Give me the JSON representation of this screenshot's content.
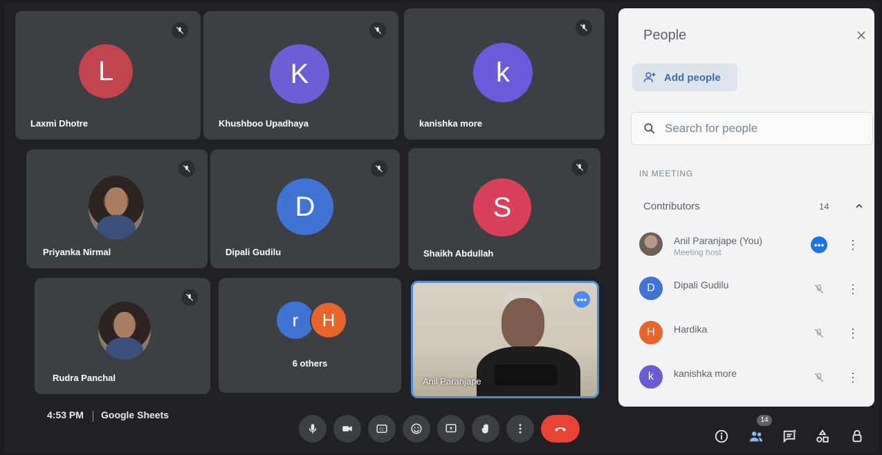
{
  "tiles": [
    {
      "name": "Laxmi Dhotre",
      "initial": "L",
      "color": "#c2444e"
    },
    {
      "name": "Khushboo Upadhaya",
      "initial": "K",
      "color": "#6c5fd6"
    },
    {
      "name": "kanishka more",
      "initial": "k",
      "color": "#6b5ad9"
    },
    {
      "name": "Priyanka Nirmal"
    },
    {
      "name": "Dipali Gudilu",
      "initial": "D",
      "color": "#3f73d4"
    },
    {
      "name": "Shaikh Abdullah",
      "initial": "S",
      "color": "#d9405a"
    },
    {
      "name": "Rudra Panchal"
    }
  ],
  "others": {
    "label": "6 others",
    "initials": [
      "r",
      "H"
    ],
    "colors": [
      "#3f73d4",
      "#e8642b"
    ]
  },
  "self_tile": {
    "name": "Anil Paranjape"
  },
  "bottom_bar": {
    "time": "4:53 PM",
    "meeting_title": "Google Sheets",
    "people_count": "14",
    "controls": [
      "mic-icon",
      "camera-icon",
      "captions-icon",
      "emoji-icon",
      "present-icon",
      "raise-hand-icon",
      "more-icon",
      "end-call-icon"
    ],
    "right_controls": [
      "info-icon",
      "people-icon",
      "chat-icon",
      "activities-icon",
      "host-controls-icon"
    ]
  },
  "panel": {
    "title": "People",
    "add_people_label": "Add people",
    "search_placeholder": "Search for people",
    "section_label": "IN MEETING",
    "contributors_label": "Contributors",
    "contributors_count": "14",
    "people": [
      {
        "name": "Anil Paranjape (You)",
        "subtitle": "Meeting host",
        "avatar": "photo"
      },
      {
        "name": "Dipali Gudilu",
        "initial": "D",
        "color": "#3f73d4"
      },
      {
        "name": "Hardika",
        "initial": "H",
        "color": "#e8642b"
      },
      {
        "name": "kanishka more",
        "initial": "k",
        "color": "#6b5ad9"
      }
    ]
  }
}
